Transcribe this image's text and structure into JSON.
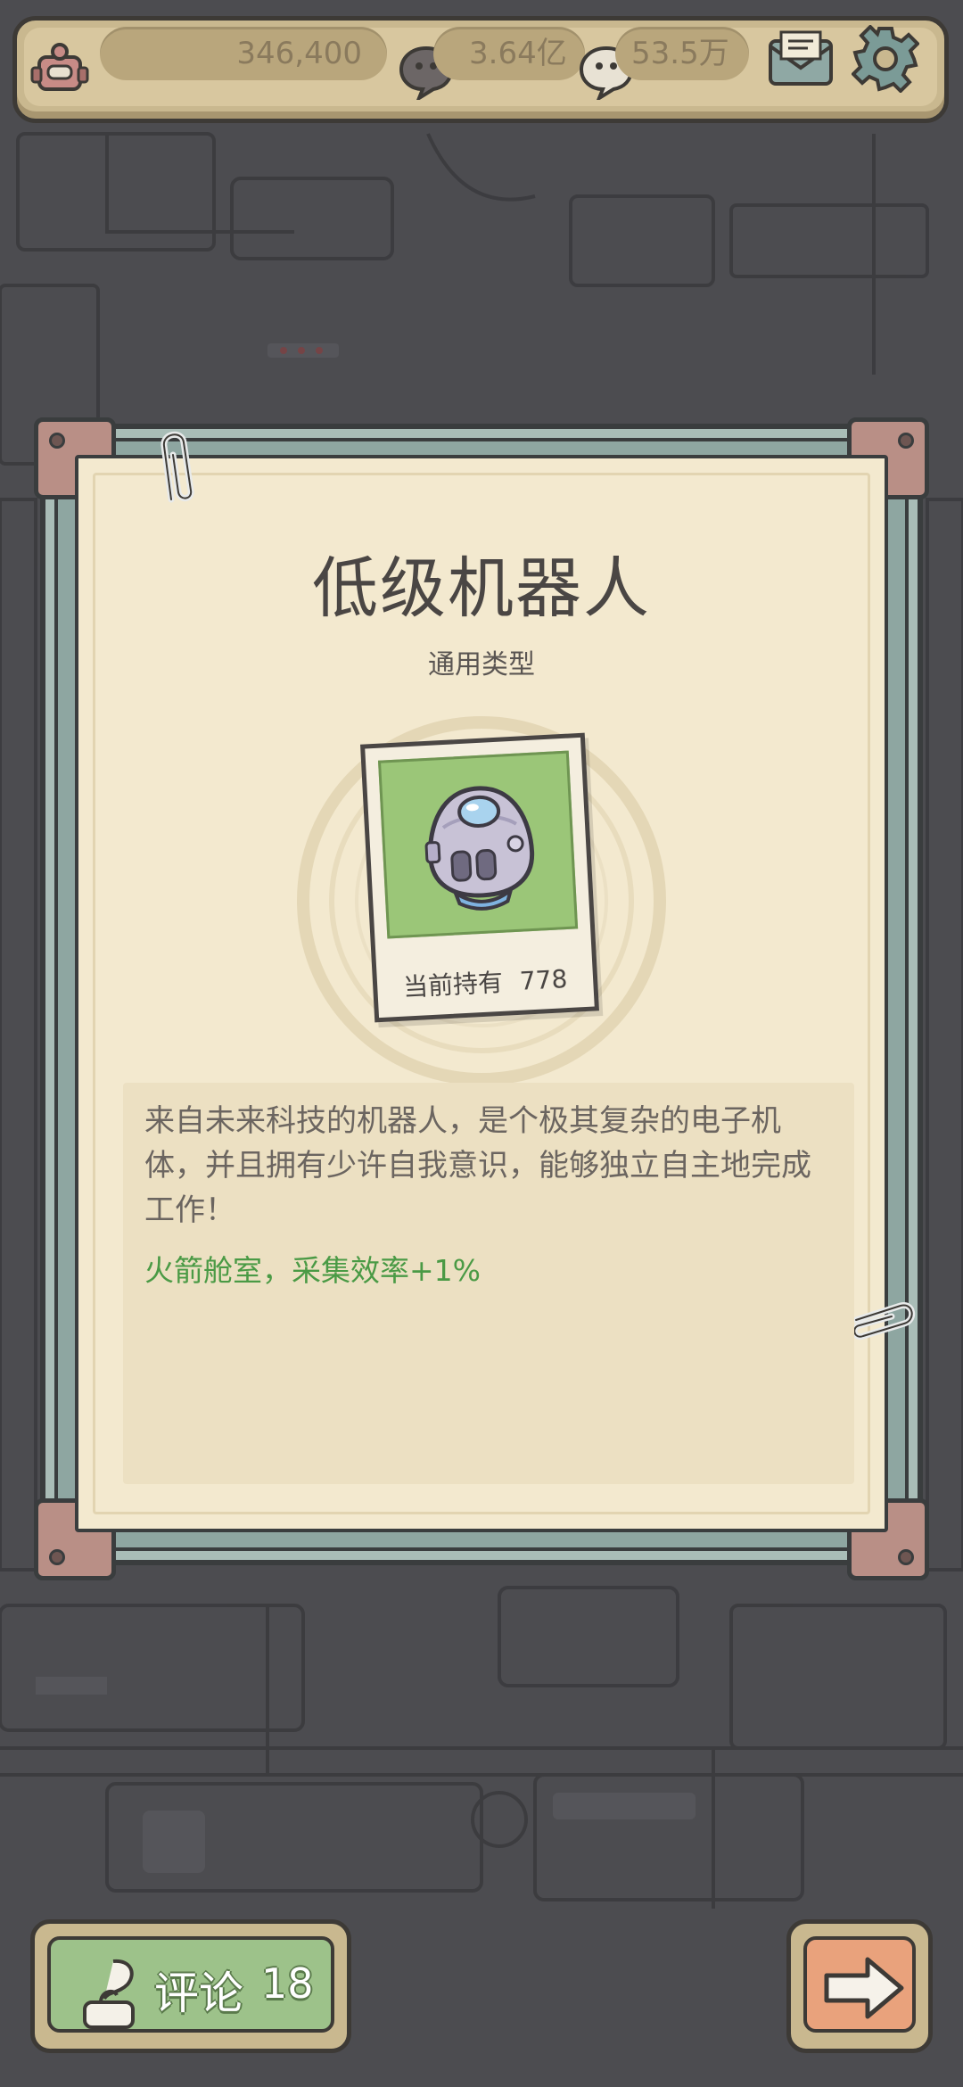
{
  "top_bar": {
    "resource_value": "346,400",
    "currency_1_value": "3.64亿",
    "currency_2_value": "53.5万",
    "icons": [
      "robot-icon",
      "chat-bubble-icon",
      "speech-bubble-icon",
      "mail-icon",
      "gear-icon"
    ]
  },
  "card": {
    "title": "低级机器人",
    "subtitle": "通用类型",
    "held_label": "当前持有",
    "held_count": "778",
    "description": "来自未来科技的机器人，是个极其复杂的电子机体，并且拥有少许自我意识，能够独立自主地完成工作！",
    "effect": "火箭舱室，采集效率+1%"
  },
  "bottom": {
    "comment_label": "评论",
    "comment_count": "18"
  },
  "colors": {
    "effect_green": "#4a9a45",
    "paper": "#f3e9cf",
    "frame": "#8ea6a1",
    "comment_button": "#9dc28a",
    "next_button": "#e9a27c"
  }
}
